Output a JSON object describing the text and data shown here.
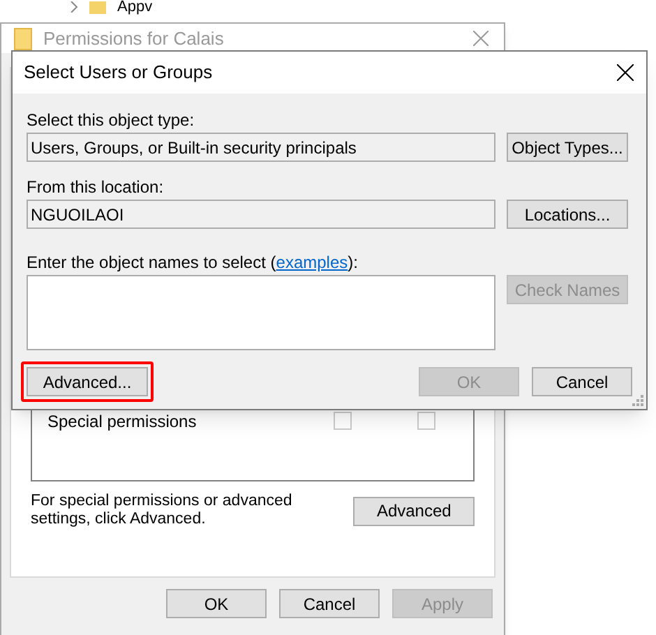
{
  "explorer": {
    "breadcrumb": "Appv"
  },
  "permissions_window": {
    "title": "Permissions for Calais",
    "active": false,
    "permissions": [
      {
        "name": "Special permissions",
        "allow": false,
        "deny": false
      }
    ],
    "advanced_note": "For special permissions or advanced settings, click Advanced.",
    "advanced_button": "Advanced",
    "buttons": [
      {
        "label": "OK",
        "disabled": false
      },
      {
        "label": "Cancel",
        "disabled": false
      },
      {
        "label": "Apply",
        "disabled": true
      }
    ]
  },
  "dialog": {
    "title": "Select Users or Groups",
    "object_type_label": "Select this object type:",
    "object_type": "Users, Groups, or Built-in security principals",
    "object_types_button": {
      "label": "Object Types...",
      "disabled": false
    },
    "location_label": "From this location:",
    "location": "NGUOILAOI",
    "locations_button": {
      "label": "Locations...",
      "disabled": false
    },
    "names_label": "Enter the object names to select (",
    "examples_link": "examples",
    "names_label_end": "):",
    "check_names_button": {
      "label": "Check Names",
      "disabled": true
    },
    "advanced_button": {
      "label": "Advanced...",
      "highlighted": true
    },
    "buttons": [
      {
        "label": "OK",
        "disabled": true
      },
      {
        "label": "Cancel",
        "disabled": false
      }
    ]
  }
}
